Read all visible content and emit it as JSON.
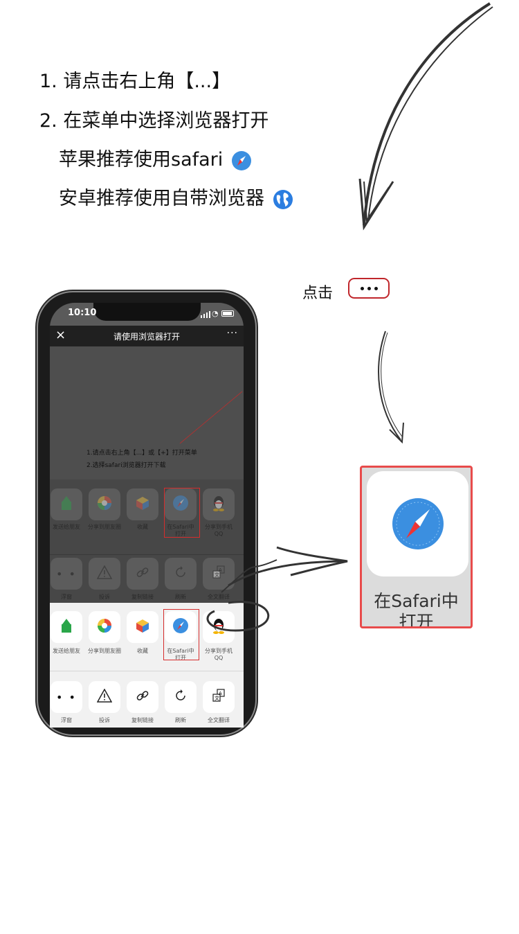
{
  "instructions": {
    "step1": "1. 请点击右上角【...】",
    "step2": "2. 在菜单中选择浏览器打开",
    "apple": "苹果推荐使用safari",
    "android": "安卓推荐使用自带浏览器"
  },
  "tap_hint": {
    "label": "点击"
  },
  "phone": {
    "time": "10:10",
    "title": "请使用浏览器打开",
    "close_icon": "close-icon",
    "more_icon": "more-icon",
    "web_lines": [
      "1.请点击右上角【...】或【+】打开菜单",
      "2.选择safari浏览器打开下载"
    ],
    "share_row": [
      "发送给朋友",
      "分享到朋友圈",
      "收藏",
      "在Safari中打开",
      "分享到手机QQ"
    ],
    "action_row": [
      "浮窗",
      "投诉",
      "复制链接",
      "刷新",
      "全文翻译"
    ],
    "dim_share_row": [
      "发送给朋友",
      "分享到朋友圈",
      "收藏",
      "在Safari中打开",
      "分享到手机QQ"
    ],
    "dim_action_row": [
      "浮窗",
      "投诉",
      "复制链接",
      "刷新",
      "全文翻译"
    ]
  },
  "callout": {
    "label": "在Safari中\n打开"
  },
  "colors": {
    "accent_red": "#e84b4b",
    "safari_blue": "#3b8fe0"
  }
}
